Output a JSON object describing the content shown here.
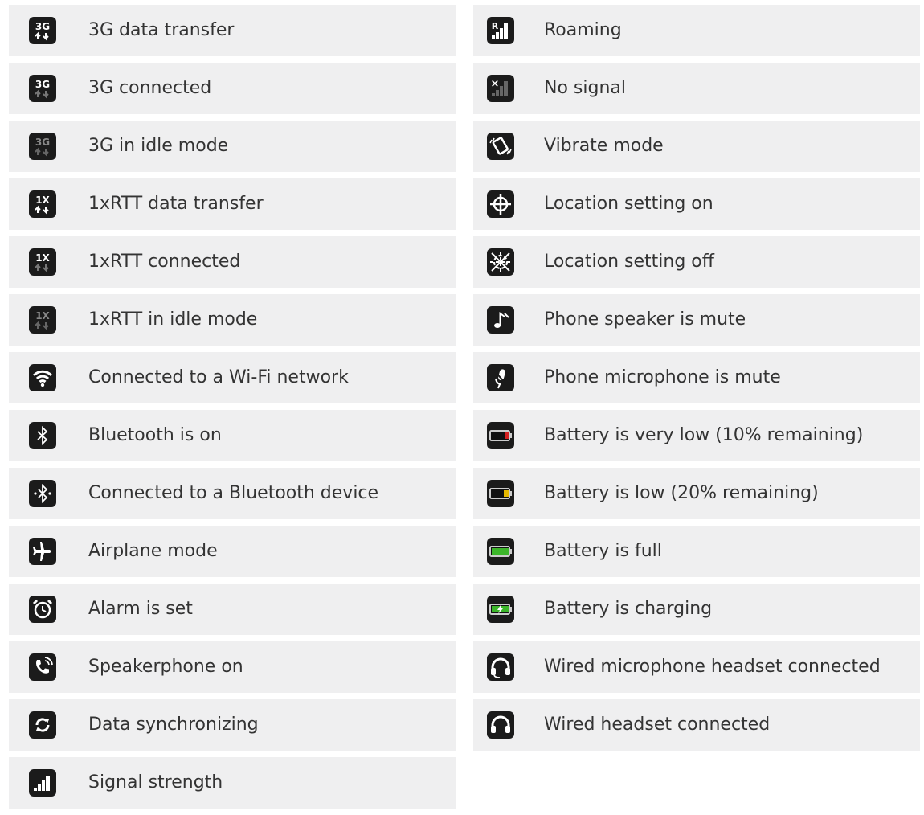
{
  "left_column": [
    {
      "icon": "3g-data-transfer-icon",
      "label": "3G data transfer"
    },
    {
      "icon": "3g-connected-icon",
      "label": "3G connected"
    },
    {
      "icon": "3g-idle-icon",
      "label": "3G in idle mode"
    },
    {
      "icon": "1xrtt-data-transfer-icon",
      "label": "1xRTT data transfer"
    },
    {
      "icon": "1xrtt-connected-icon",
      "label": "1xRTT connected"
    },
    {
      "icon": "1xrtt-idle-icon",
      "label": "1xRTT in idle mode"
    },
    {
      "icon": "wifi-icon",
      "label": "Connected to a Wi-Fi network"
    },
    {
      "icon": "bluetooth-icon",
      "label": "Bluetooth is on"
    },
    {
      "icon": "bluetooth-connected-icon",
      "label": "Connected to a Bluetooth device"
    },
    {
      "icon": "airplane-icon",
      "label": "Airplane mode"
    },
    {
      "icon": "alarm-icon",
      "label": "Alarm is set"
    },
    {
      "icon": "speakerphone-icon",
      "label": "Speakerphone on"
    },
    {
      "icon": "sync-icon",
      "label": "Data synchronizing"
    },
    {
      "icon": "signal-strength-icon",
      "label": "Signal strength"
    }
  ],
  "right_column": [
    {
      "icon": "roaming-icon",
      "label": "Roaming"
    },
    {
      "icon": "no-signal-icon",
      "label": "No signal"
    },
    {
      "icon": "vibrate-icon",
      "label": "Vibrate mode"
    },
    {
      "icon": "location-on-icon",
      "label": "Location setting on"
    },
    {
      "icon": "location-off-icon",
      "label": "Location setting off"
    },
    {
      "icon": "speaker-mute-icon",
      "label": "Phone speaker is mute"
    },
    {
      "icon": "microphone-mute-icon",
      "label": "Phone microphone is mute"
    },
    {
      "icon": "battery-very-low-icon",
      "label": "Battery is very low (10% remaining)"
    },
    {
      "icon": "battery-low-icon",
      "label": "Battery is low (20% remaining)"
    },
    {
      "icon": "battery-full-icon",
      "label": "Battery is full"
    },
    {
      "icon": "battery-charging-icon",
      "label": "Battery is charging"
    },
    {
      "icon": "headset-mic-icon",
      "label": "Wired microphone headset connected"
    },
    {
      "icon": "headset-icon",
      "label": "Wired headset connected"
    }
  ],
  "icon_text": {
    "three_g": "3G",
    "one_x": "1X",
    "roaming_r": "R",
    "no_signal_x": "×"
  },
  "colors": {
    "row_bg": "#efeff0",
    "icon_bg": "#1b1b1b",
    "text": "#333333",
    "battery_red": "#d42020",
    "battery_yellow": "#e6b800",
    "battery_green": "#3cb62a"
  }
}
